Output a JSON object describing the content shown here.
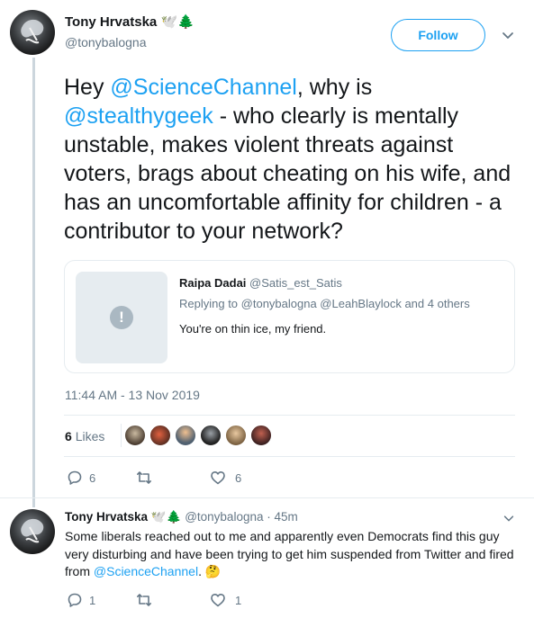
{
  "main_tweet": {
    "author_name": "Tony Hrvatska",
    "author_emoji": "🕊️🌲",
    "author_handle": "@tonybalogna",
    "follow_label": "Follow",
    "text_parts": {
      "p1": "Hey ",
      "m1": "@ScienceChannel",
      "p2": ", why is ",
      "m2": "@stealthygeek",
      "p3": " - who clearly is mentally unstable, makes violent threats against voters, brags about cheating on his wife, and has an uncomfortable affinity for children - a contributor to your network?"
    },
    "quoted": {
      "name": "Raipa Dadai",
      "handle": "@Satis_est_Satis",
      "replying_prefix": "Replying to ",
      "replying_to": "@tonybalogna @LeahBlaylock",
      "replying_suffix": " and 4 others",
      "text": "You're on thin ice, my friend.",
      "media_icon": "!"
    },
    "timestamp": "11:44 AM - 13 Nov 2019",
    "likes_number": "6",
    "likes_label": "Likes",
    "actions": {
      "replies": "6",
      "likes": "6"
    }
  },
  "reply_tweet": {
    "author_name": "Tony Hrvatska",
    "author_emoji": "🕊️🌲",
    "author_handle": "@tonybalogna",
    "time": "· 45m",
    "text_before": "Some liberals reached out to me and apparently even Democrats find this guy very disturbing and have been trying to get him suspended from Twitter and fired from ",
    "mention": "@ScienceChannel",
    "text_after": ". 🤔",
    "actions": {
      "replies": "1",
      "likes": "1"
    }
  },
  "icons": [
    "chevron-down-icon",
    "reply-icon",
    "retweet-icon",
    "heart-icon",
    "alert-icon"
  ],
  "colors": {
    "accent": "#1da1f2",
    "secondary_text": "#657786",
    "primary_text": "#14171a"
  }
}
